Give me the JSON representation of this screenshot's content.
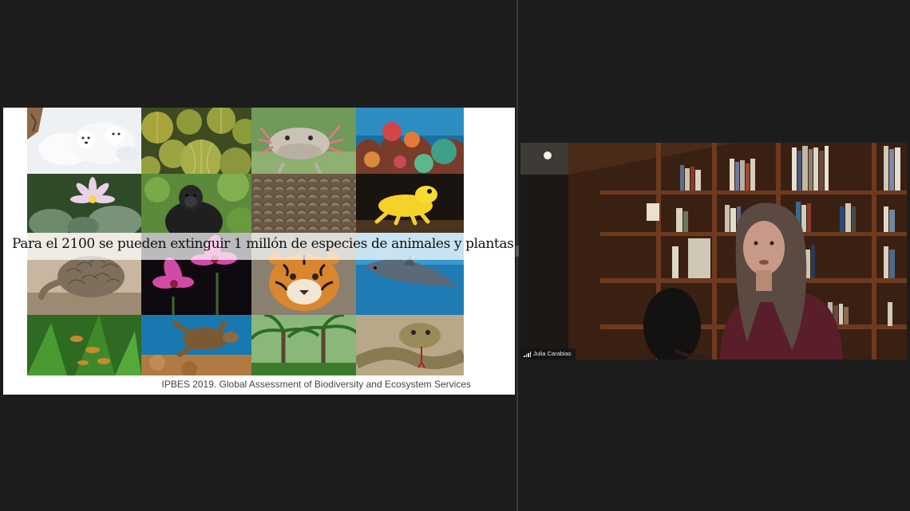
{
  "slide": {
    "caption": "Para el 2100 se pueden extinguir 1 millón de especies de animales y plantas",
    "source": "IPBES 2019. Global Assessment of Biodiversity and Ecosystem Services"
  },
  "participant": {
    "name": "Julia Carabias",
    "icons": [
      "signal-bars-icon"
    ]
  },
  "colors": {
    "background": "#1c1c1c",
    "slide_background": "#ffffff",
    "divider": "#3a3a3a"
  }
}
